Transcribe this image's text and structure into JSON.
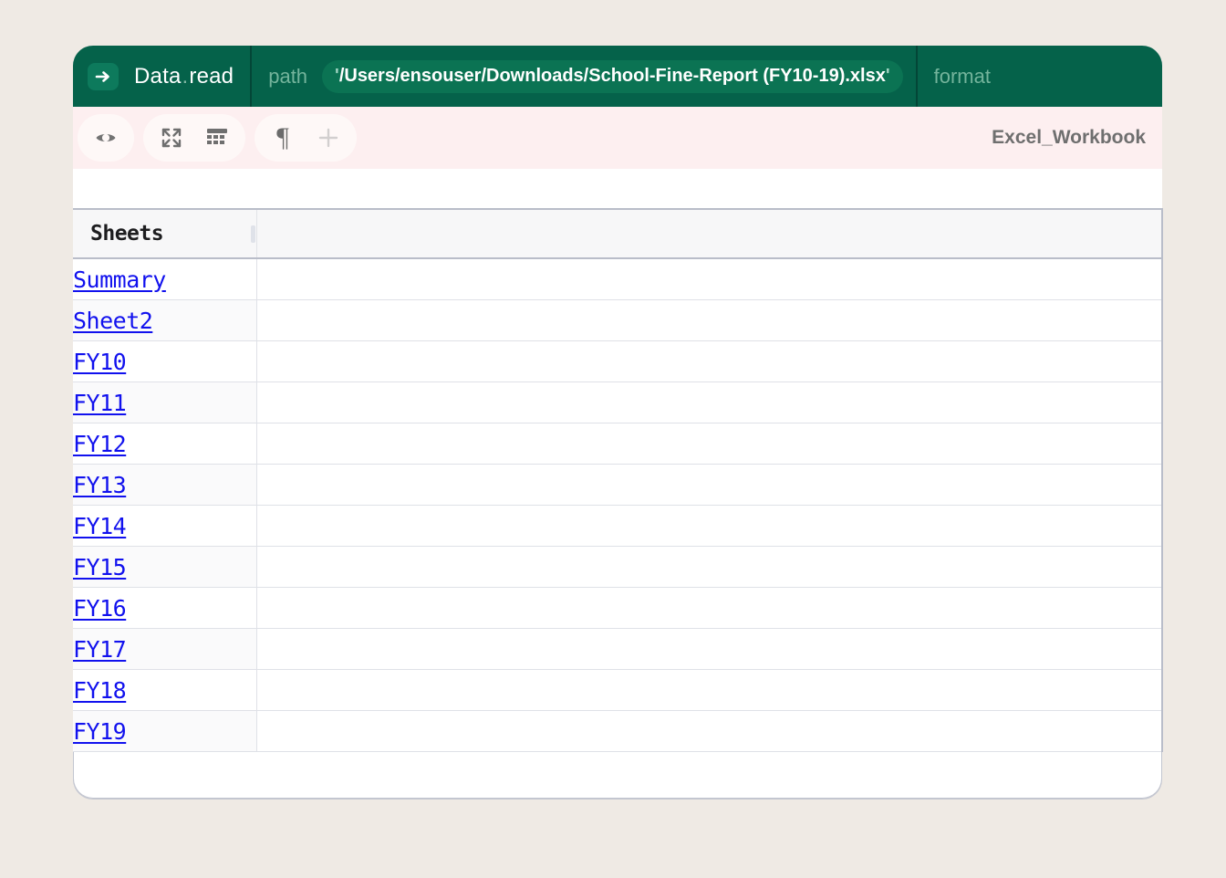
{
  "signature": {
    "arrow_icon": "arrow-right-icon",
    "function_name": "Data",
    "dot": ".",
    "method_name": "read",
    "args": [
      {
        "key": "path",
        "value": "'/Users/ensouser/Downloads/School-Fine-Report  (FY10-19).xlsx'",
        "quote_open": "'",
        "quote_close": "'",
        "value_text": "/Users/ensouser/Downloads/School-Fine-Report  (FY10-19).xlsx"
      },
      {
        "key": "format",
        "value": ""
      }
    ]
  },
  "toolbar": {
    "buttons": [
      {
        "name": "eye-icon",
        "label": "preview"
      },
      {
        "name": "expand-icon",
        "label": "expand"
      },
      {
        "name": "table-icon",
        "label": "table view"
      },
      {
        "name": "pilcrow-icon",
        "label": "¶"
      },
      {
        "name": "plus-icon",
        "label": "add"
      }
    ],
    "type_label": "Excel_Workbook"
  },
  "table": {
    "columns": [
      "Sheets"
    ],
    "rows": [
      {
        "name": "Summary"
      },
      {
        "name": "Sheet2"
      },
      {
        "name": "FY10"
      },
      {
        "name": "FY11"
      },
      {
        "name": "FY12"
      },
      {
        "name": "FY13"
      },
      {
        "name": "FY14"
      },
      {
        "name": "FY15"
      },
      {
        "name": "FY16"
      },
      {
        "name": "FY17"
      },
      {
        "name": "FY18"
      },
      {
        "name": "FY19"
      }
    ]
  },
  "colors": {
    "page_bg": "#efeae4",
    "header_green": "#05624a",
    "pill_green": "#0b7353",
    "badge_green": "#0d7a5c",
    "toolbar_pink": "#fdeff0",
    "link_blue": "#1111ee",
    "border_gray": "#b9bdc9"
  }
}
